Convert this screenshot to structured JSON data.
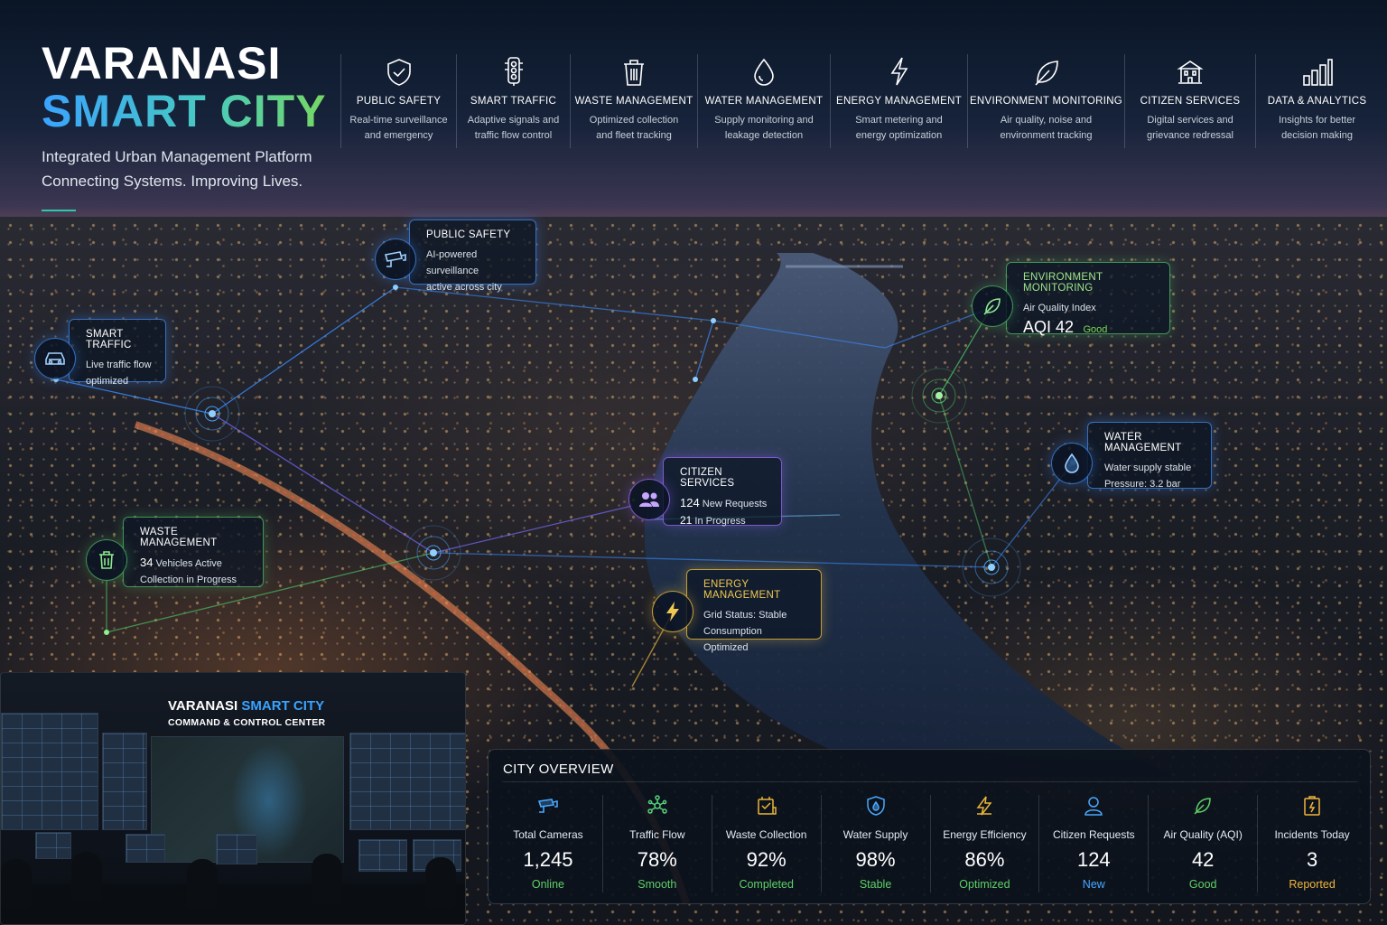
{
  "brand": {
    "line1": "VARANASI",
    "line2": "SMART CITY",
    "tagline1": "Integrated Urban Management Platform",
    "tagline2": "Connecting Systems. Improving Lives."
  },
  "modules": [
    {
      "icon": "shield-check-icon",
      "title": "PUBLIC SAFETY",
      "desc": "Real-time surveillance\nand emergency",
      "width": 128
    },
    {
      "icon": "traffic-light-icon",
      "title": "SMART TRAFFIC",
      "desc": "Adaptive signals and\ntraffic flow control",
      "width": 126
    },
    {
      "icon": "trash-bin-icon",
      "title": "WASTE MANAGEMENT",
      "desc": "Optimized collection\nand fleet tracking",
      "width": 141
    },
    {
      "icon": "water-drop-icon",
      "title": "WATER MANAGEMENT",
      "desc": "Supply monitoring and\nleakage detection",
      "width": 147
    },
    {
      "icon": "lightning-bolt-icon",
      "title": "ENERGY MANAGEMENT",
      "desc": "Smart metering and\nenergy optimization",
      "width": 152
    },
    {
      "icon": "leaf-icon",
      "title": "ENVIRONMENT MONITORING",
      "desc": "Air quality, noise and\nenvironment tracking",
      "width": 174
    },
    {
      "icon": "government-building-icon",
      "title": "CITIZEN SERVICES",
      "desc": "Digital services and\ngrievance redressal",
      "width": 145
    },
    {
      "icon": "bar-chart-icon",
      "title": "DATA & ANALYTICS",
      "desc": "Insights for better\ndecision making",
      "width": 136
    }
  ],
  "callouts": {
    "public_safety": {
      "title": "PUBLIC SAFETY",
      "line1": "AI-powered surveillance",
      "line2": "active across city"
    },
    "smart_traffic": {
      "title": "SMART TRAFFIC",
      "line1": "Live traffic flow",
      "line2": "optimized"
    },
    "environment": {
      "title": "ENVIRONMENT MONITORING",
      "line1": "Air Quality Index",
      "aqi": "AQI 42",
      "aqi_status": "Good"
    },
    "water": {
      "title": "WATER MANAGEMENT",
      "line1": "Water supply stable",
      "line2": "Pressure: 3.2 bar"
    },
    "citizen": {
      "title": "CITIZEN SERVICES",
      "count1": "124",
      "text1": "New Requests",
      "count2": "21",
      "text2": "In Progress"
    },
    "waste": {
      "title": "WASTE MANAGEMENT",
      "count1": "34",
      "text1": "Vehicles Active",
      "line2": "Collection in Progress"
    },
    "energy": {
      "title": "ENERGY MANAGEMENT",
      "line1": "Grid Status: Stable",
      "line2": "Consumption Optimized"
    }
  },
  "command_center": {
    "title_a": "VARANASI",
    "title_b": "SMART CITY",
    "subtitle": "COMMAND & CONTROL CENTER"
  },
  "overview": {
    "title": "CITY OVERVIEW",
    "stats": [
      {
        "icon": "cctv-camera-icon",
        "label": "Total Cameras",
        "value": "1,245",
        "status": "Online",
        "color": "#5fd068",
        "icon_color": "#4aa8ff"
      },
      {
        "icon": "network-nodes-icon",
        "label": "Traffic Flow",
        "value": "78%",
        "status": "Smooth",
        "color": "#5fd068",
        "icon_color": "#55d17a"
      },
      {
        "icon": "waste-truck-icon",
        "label": "Waste Collection",
        "value": "92%",
        "status": "Completed",
        "color": "#5fd068",
        "icon_color": "#e8b53a"
      },
      {
        "icon": "water-shield-icon",
        "label": "Water Supply",
        "value": "98%",
        "status": "Stable",
        "color": "#5fd068",
        "icon_color": "#4aa8ff"
      },
      {
        "icon": "lightning-bolt-icon",
        "label": "Energy Efficiency",
        "value": "86%",
        "status": "Optimized",
        "color": "#5fd068",
        "icon_color": "#e8b53a"
      },
      {
        "icon": "user-icon",
        "label": "Citizen Requests",
        "value": "124",
        "status": "New",
        "color": "#4aa8ff",
        "icon_color": "#4aa8ff"
      },
      {
        "icon": "leaf-icon",
        "label": "Air Quality (AQI)",
        "value": "42",
        "status": "Good",
        "color": "#5fd068",
        "icon_color": "#5fd068"
      },
      {
        "icon": "alert-clipboard-icon",
        "label": "Incidents Today",
        "value": "3",
        "status": "Reported",
        "color": "#f0b43c",
        "icon_color": "#f0b43c"
      }
    ]
  }
}
